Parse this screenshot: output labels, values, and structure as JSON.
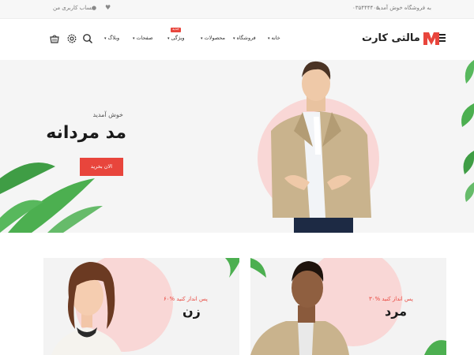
{
  "topbar": {
    "welcome": "به فروشگاه خوش آمدید",
    "phone": "۰۳۵۴۴۴۴۰۵",
    "account": "حساب کاربری من"
  },
  "header": {
    "logo_text": "مالتی کارت",
    "nav": [
      {
        "label": "خانه"
      },
      {
        "label": "فروشگاه"
      },
      {
        "label": "محصولات"
      },
      {
        "label": "ویژگی",
        "badge": "جدید"
      },
      {
        "label": "صفحات"
      },
      {
        "label": "وبلاگ"
      }
    ]
  },
  "hero": {
    "welcome": "خوش آمدید",
    "title": "مد مردانه",
    "button": "الان بخرید"
  },
  "categories": [
    {
      "discount": "۶۰% پس انداز کنید",
      "name": "زن"
    },
    {
      "discount": "۳۰% پس انداز کنید",
      "name": "مرد"
    }
  ],
  "colors": {
    "accent": "#e8453c",
    "pink": "#f9d7d6",
    "leaf": "#4caf50"
  },
  "icons": [
    "heart-icon",
    "user-icon",
    "menu-icon",
    "cart-icon",
    "settings-icon",
    "search-icon",
    "chevron-down-icon"
  ]
}
